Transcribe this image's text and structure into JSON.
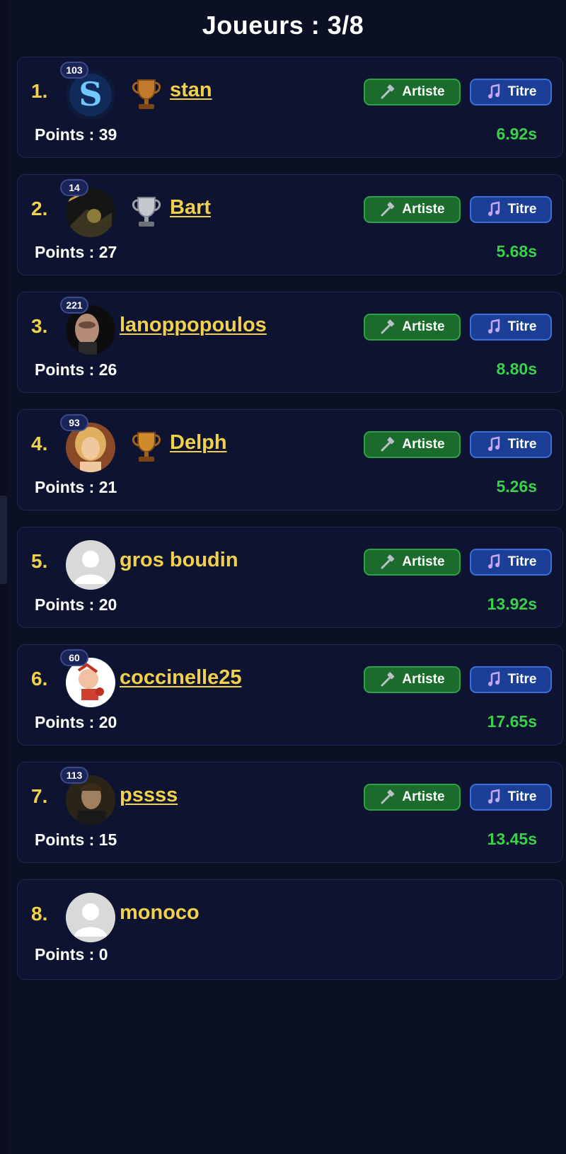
{
  "header": {
    "title": "Joueurs : 3/8"
  },
  "buttons": {
    "artist": "Artiste",
    "title": "Titre"
  },
  "players": [
    {
      "rank": "1.",
      "level": "103",
      "name": "stan",
      "trophy": "bronze-trophy",
      "points": "Points : 39",
      "time": "6.92s",
      "avatar": "letter-s-avatar"
    },
    {
      "rank": "2.",
      "level": "14",
      "name": "Bart",
      "trophy": "silver-trophy",
      "points": "Points : 27",
      "time": "5.68s",
      "avatar": "photo-avatar"
    },
    {
      "rank": "3.",
      "level": "221",
      "name": "lanoppopoulos",
      "trophy": null,
      "points": "Points : 26",
      "time": "8.80s",
      "avatar": "photo-avatar"
    },
    {
      "rank": "4.",
      "level": "93",
      "name": "Delph",
      "trophy": "bronze-trophy",
      "points": "Points : 21",
      "time": "5.26s",
      "avatar": "illustration-avatar"
    },
    {
      "rank": "5.",
      "level": null,
      "name": "gros boudin",
      "trophy": null,
      "points": "Points : 20",
      "time": "13.92s",
      "avatar": "default-user-avatar"
    },
    {
      "rank": "6.",
      "level": "60",
      "name": "coccinelle25",
      "trophy": null,
      "points": "Points : 20",
      "time": "17.65s",
      "avatar": "illustration-avatar"
    },
    {
      "rank": "7.",
      "level": "113",
      "name": "pssss",
      "trophy": null,
      "points": "Points : 15",
      "time": "13.45s",
      "avatar": "photo-avatar"
    },
    {
      "rank": "8.",
      "level": null,
      "name": "monoco",
      "trophy": null,
      "points": "Points : 0",
      "time": null,
      "avatar": "default-user-avatar"
    }
  ],
  "colors": {
    "background": "#0b1024",
    "card": "#0d1330",
    "name": "#f2d14a",
    "time": "#39d14a",
    "artist_button": "#1b6b2c",
    "title_button": "#1b3f96"
  }
}
